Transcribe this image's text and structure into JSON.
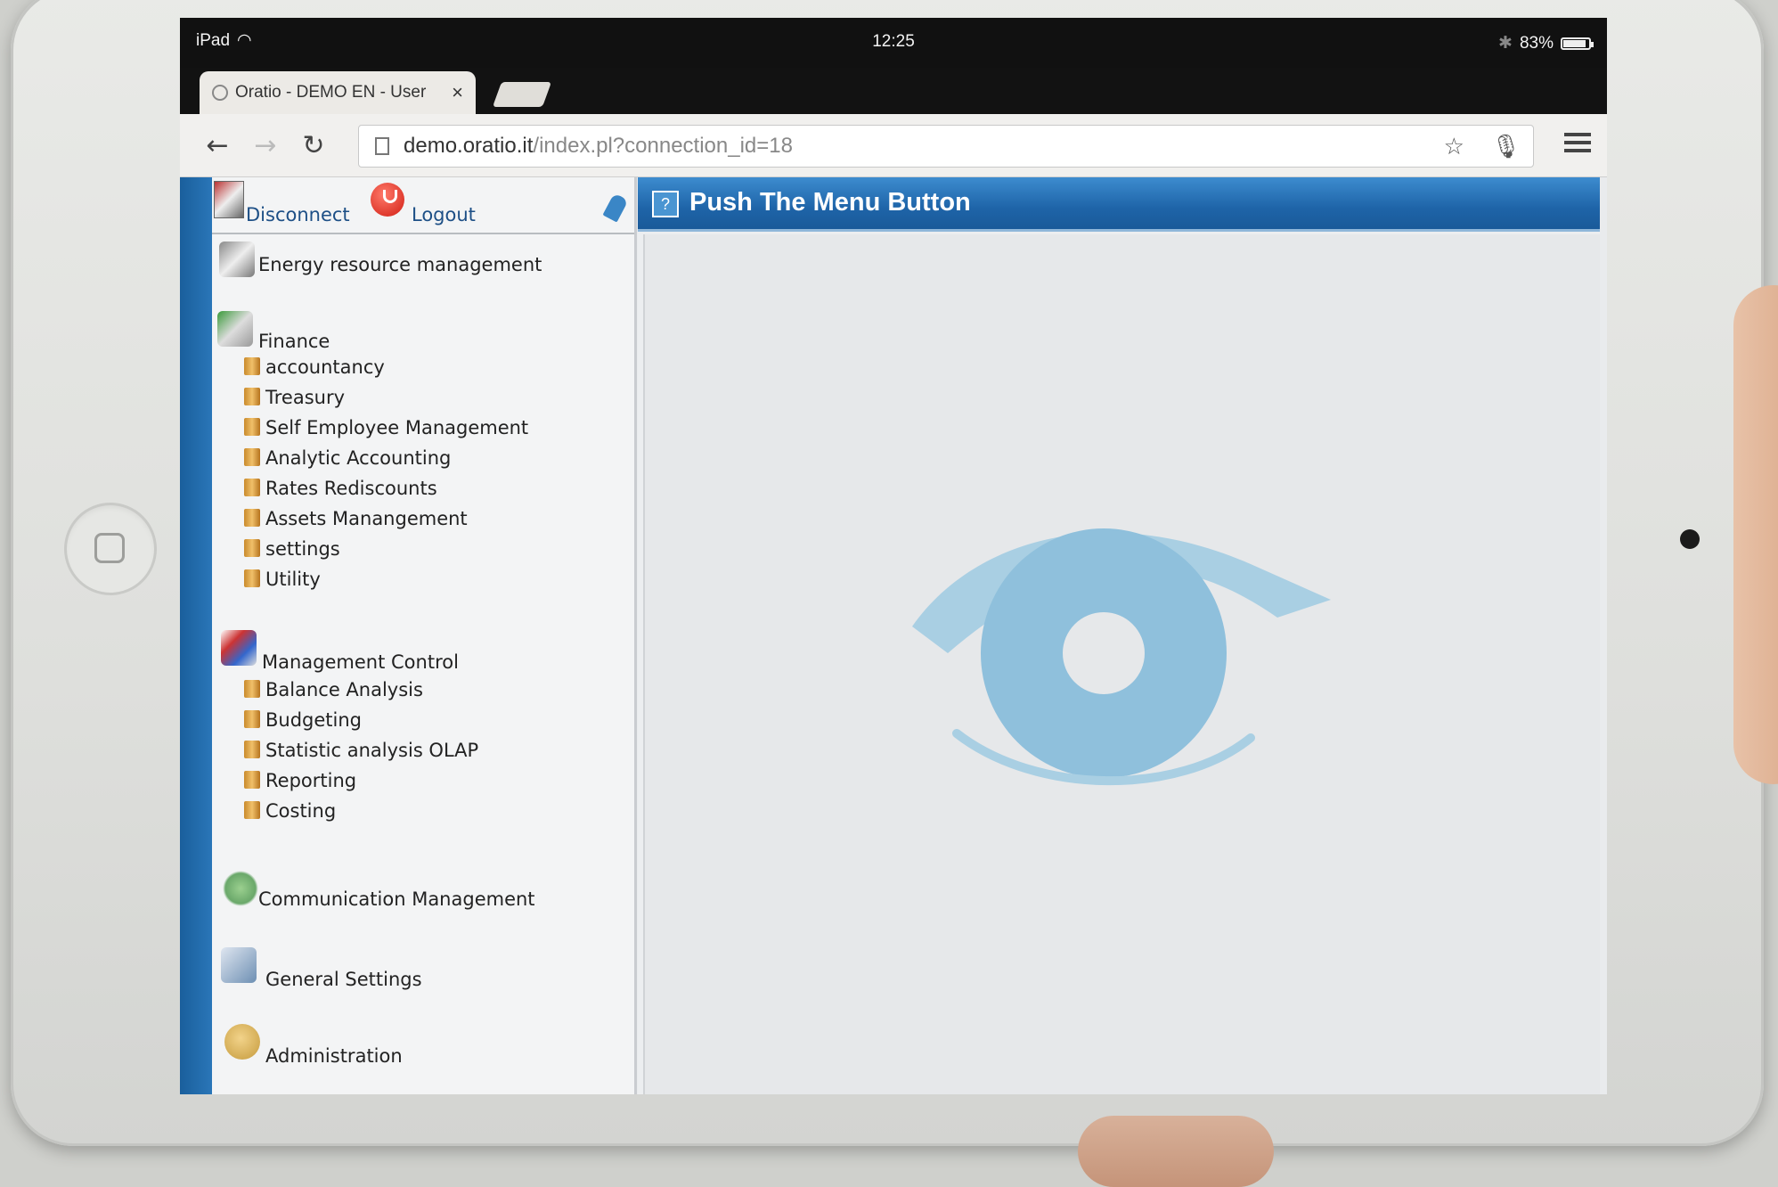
{
  "device": {
    "model_label": "iPad"
  },
  "statusbar": {
    "carrier": "iPad",
    "time": "12:25",
    "battery": "83%",
    "battery_level": 0.83
  },
  "browser": {
    "tab_title": "Oratio - DEMO EN - User",
    "url_host": "demo.oratio.it",
    "url_path": "/index.pl?connection_id=18"
  },
  "sidebar": {
    "disconnect_label": "Disconnect",
    "logout_label": "Logout",
    "sections": [
      {
        "label": "Energy resource management",
        "items": []
      },
      {
        "label": "Finance",
        "items": [
          "accountancy",
          "Treasury",
          "Self Employee Management",
          "Analytic Accounting",
          "Rates Rediscounts",
          "Assets Manangement",
          "settings",
          "Utility"
        ]
      },
      {
        "label": "Management Control",
        "items": [
          "Balance Analysis",
          "Budgeting",
          "Statistic analysis OLAP",
          "Reporting",
          "Costing"
        ]
      },
      {
        "label": "Communication Management",
        "items": []
      },
      {
        "label": "General Settings",
        "items": []
      },
      {
        "label": "Administration",
        "items": []
      }
    ]
  },
  "content": {
    "header_title": "Push The Menu Button",
    "help_icon_glyph": "?"
  },
  "colors": {
    "accent_blue": "#1e64a8",
    "eye_logo": "#a9cfe3",
    "power_red": "#d11e14"
  }
}
